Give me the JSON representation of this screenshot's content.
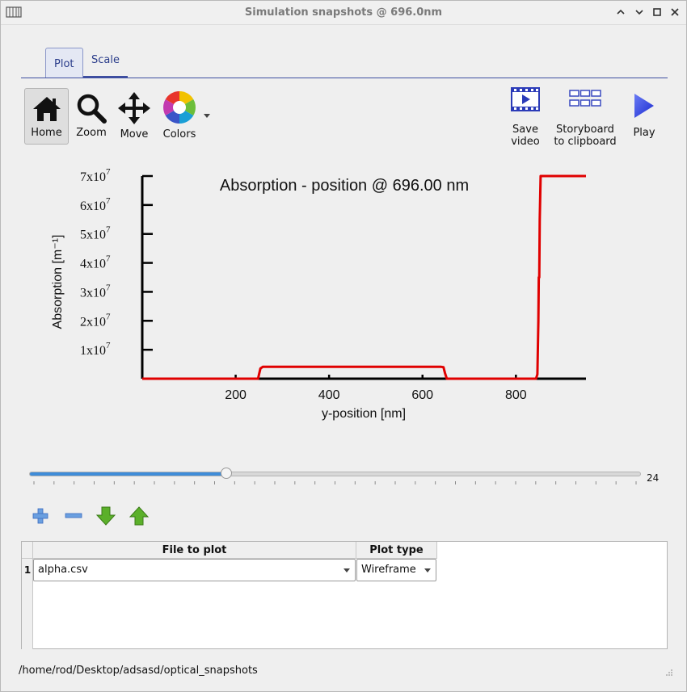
{
  "window": {
    "title": "Simulation snapshots @ 696.0nm",
    "controls": [
      "minimize",
      "restore",
      "maximize",
      "close"
    ]
  },
  "tabs": [
    {
      "label": "Plot",
      "active": true
    },
    {
      "label": "Scale",
      "active": false
    }
  ],
  "toolbar": {
    "home": "Home",
    "zoom": "Zoom",
    "move": "Move",
    "colors": "Colors",
    "save_video_1": "Save",
    "save_video_2": "video",
    "storyboard_1": "Storyboard",
    "storyboard_2": "to clipboard",
    "play": "Play"
  },
  "chart_data": {
    "type": "line",
    "title": "Absorption - position @ 696.00 nm",
    "xlabel": "y-position [nm]",
    "ylabel": "Absorption [m⁻¹]",
    "xlim": [
      0,
      950
    ],
    "ylim": [
      0,
      70000000
    ],
    "xticks": [
      "200",
      "400",
      "600",
      "800"
    ],
    "xtick_values": [
      200,
      400,
      600,
      800
    ],
    "ytick_values": [
      10000000,
      20000000,
      30000000,
      40000000,
      50000000,
      60000000,
      70000000
    ],
    "ytick_mantissa": [
      "1",
      "2",
      "3",
      "4",
      "5",
      "6",
      "7"
    ],
    "ytick_base": "x10",
    "ytick_exp": "7",
    "color": "#e00000",
    "series": [
      {
        "x": [
          0,
          248,
          250,
          253,
          258,
          640,
          645,
          648,
          652,
          843,
          846,
          848,
          849,
          850,
          851,
          853,
          950
        ],
        "y": [
          0,
          0,
          1500000,
          3500000,
          4100000,
          4100000,
          4000000,
          2000000,
          0,
          0,
          1500000,
          20000000,
          35000000,
          35000000,
          55000000,
          70000000,
          70000000
        ]
      }
    ]
  },
  "slider": {
    "value": "24",
    "fraction": 0.322
  },
  "list_buttons": [
    "add-icon",
    "remove-icon",
    "move-down-icon",
    "move-up-icon"
  ],
  "table": {
    "headers": [
      "File to plot",
      "Plot type"
    ],
    "rows": [
      {
        "num": "1",
        "file": "alpha.csv",
        "plot_type": "Wireframe"
      }
    ]
  },
  "status": {
    "path": "/home/rod/Desktop/adsasd/optical_snapshots"
  }
}
